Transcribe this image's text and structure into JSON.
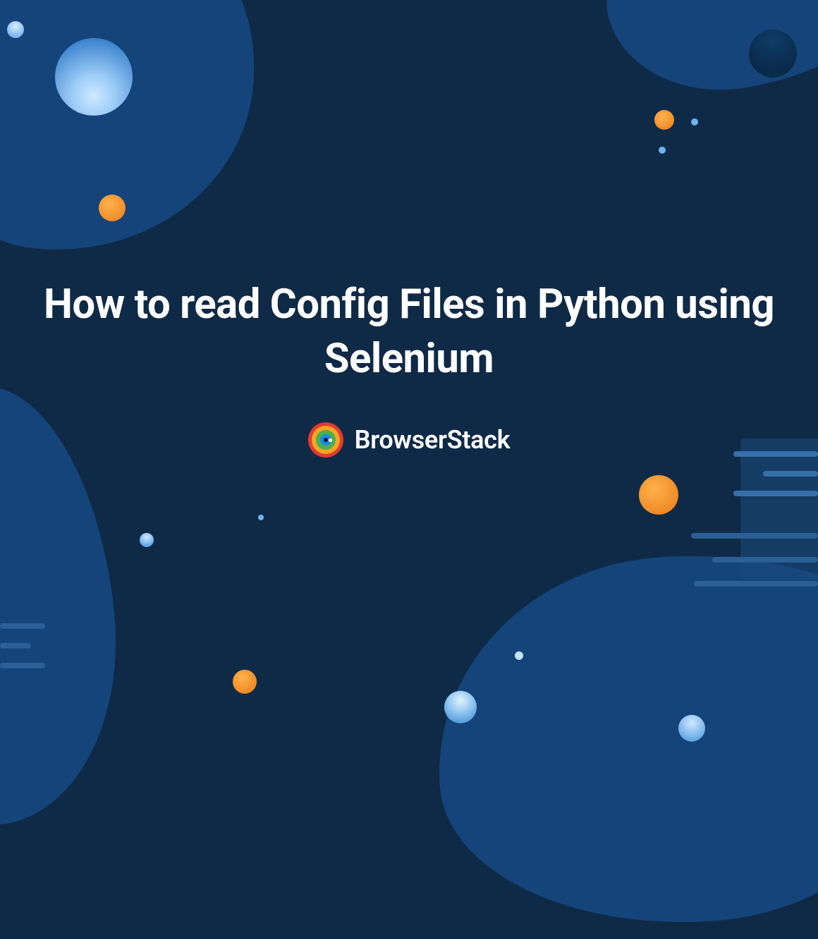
{
  "title": "How to read Config Files in Python using Selenium",
  "brand": "BrowserStack"
}
